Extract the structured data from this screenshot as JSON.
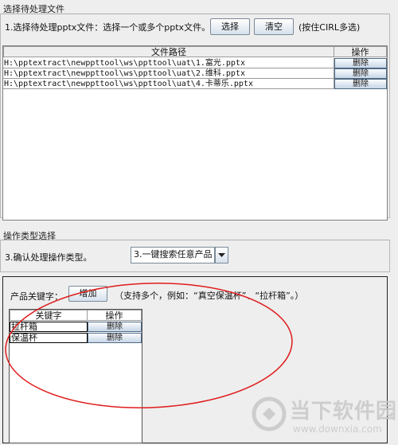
{
  "file_section": {
    "title": "选择待处理文件",
    "step_label": "1.选择待处理pptx文件：选择一个或多个pptx文件。",
    "select_button": "选择",
    "clear_button": "清空",
    "hint": "(按住CIRL多选)",
    "table": {
      "col_path": "文件路径",
      "col_action": "操作",
      "rows": [
        {
          "path": "H:\\pptextract\\newppttool\\ws\\ppttool\\uat\\1.富光.pptx",
          "action": "删除"
        },
        {
          "path": "H:\\pptextract\\newppttool\\ws\\ppttool\\uat\\2.维科.pptx",
          "action": "删除"
        },
        {
          "path": "H:\\pptextract\\newppttool\\ws\\ppttool\\uat\\4.卡蒂乐.pptx",
          "action": "删除"
        }
      ]
    }
  },
  "op_section": {
    "title": "操作类型选择",
    "step_label": "3.确认处理操作类型。",
    "combo_value": "3.一键搜索任意产品"
  },
  "keyword_section": {
    "label": "产品关键字：",
    "add_button": "增加",
    "hint": "（支持多个，例如：“真空保温杯”、“拉杆箱”。）",
    "table": {
      "col_keyword": "关键字",
      "col_action": "操作",
      "rows": [
        {
          "keyword": "拉杆箱",
          "action": "删除"
        },
        {
          "keyword": "保温杯",
          "action": "删除"
        }
      ]
    }
  },
  "watermark": {
    "brand": "当下软件园",
    "url": "www.downxia.com"
  },
  "colors": {
    "annotation_ellipse": "#e01b1b",
    "watermark": "#c8c8c8"
  }
}
